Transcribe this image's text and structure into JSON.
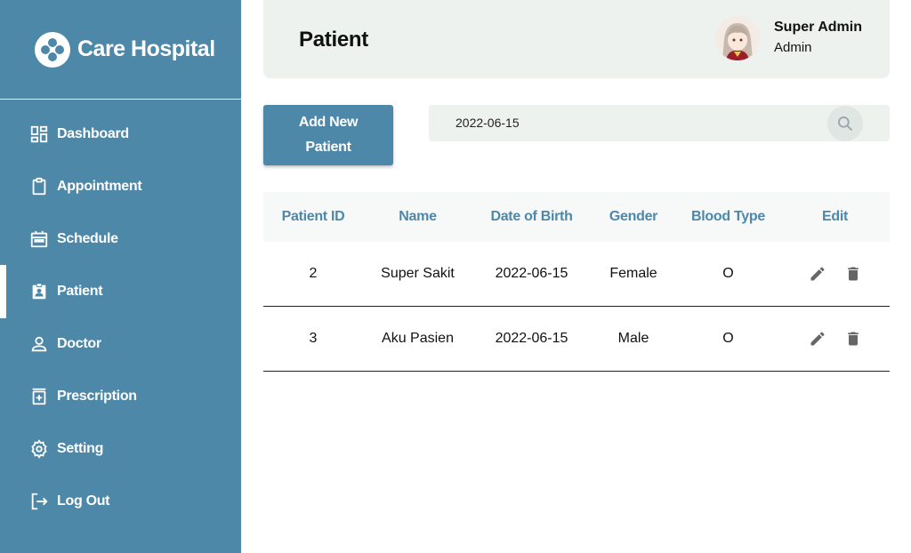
{
  "brand": {
    "name": "Care Hospital"
  },
  "nav": [
    {
      "label": "Dashboard",
      "icon": "dashboard-icon",
      "active": false
    },
    {
      "label": "Appointment",
      "icon": "clipboard-icon",
      "active": false
    },
    {
      "label": "Schedule",
      "icon": "calendar-icon",
      "active": false
    },
    {
      "label": "Patient",
      "icon": "patient-badge-icon",
      "active": true
    },
    {
      "label": "Doctor",
      "icon": "person-icon",
      "active": false
    },
    {
      "label": "Prescription",
      "icon": "prescription-icon",
      "active": false
    },
    {
      "label": "Setting",
      "icon": "gear-icon",
      "active": false
    },
    {
      "label": "Log Out",
      "icon": "logout-icon",
      "active": false
    }
  ],
  "header": {
    "title": "Patient",
    "user_name": "Super Admin",
    "user_role": "Admin"
  },
  "actions": {
    "add_line1": "Add New",
    "add_line2": "Patient",
    "search_value": "2022-06-15"
  },
  "table": {
    "columns": [
      "Patient ID",
      "Name",
      "Date of Birth",
      "Gender",
      "Blood Type",
      "Edit"
    ],
    "rows": [
      {
        "id": "2",
        "name": "Super Sakit",
        "dob": "2022-06-15",
        "gender": "Female",
        "blood": "O"
      },
      {
        "id": "3",
        "name": "Aku Pasien",
        "dob": "2022-06-15",
        "gender": "Male",
        "blood": "O"
      }
    ]
  },
  "colors": {
    "sidebar": "#4d88a9",
    "accent": "#4d88a9",
    "header_bg": "#eef2ee"
  }
}
